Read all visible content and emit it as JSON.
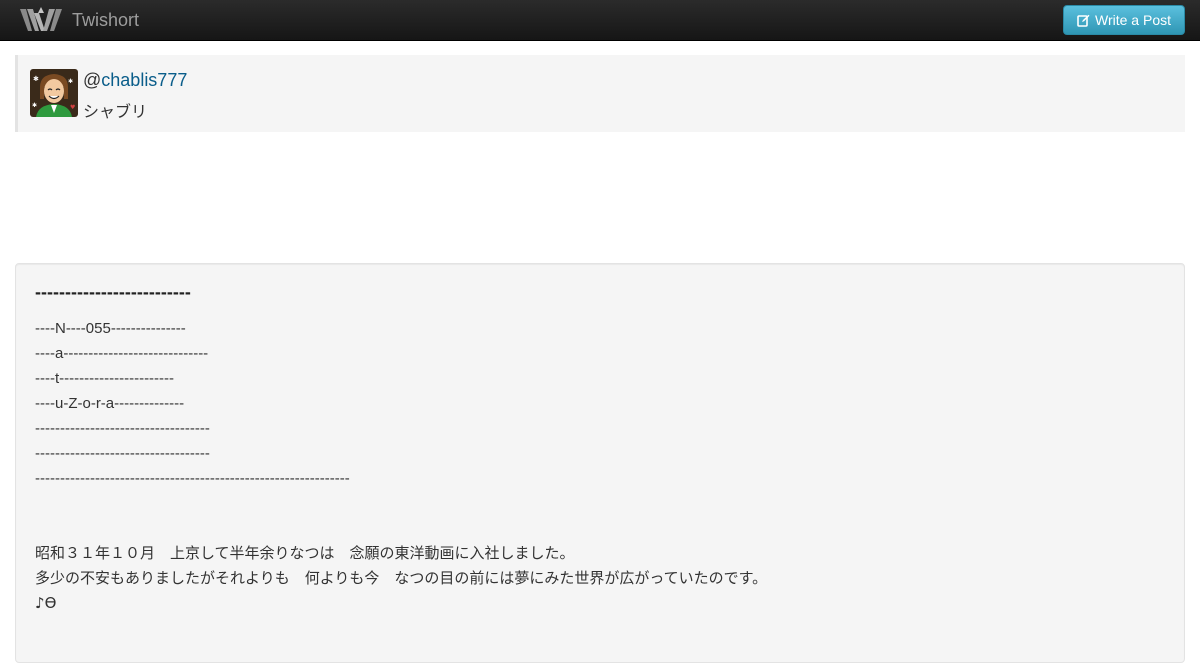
{
  "navbar": {
    "brand_text": "Twishort",
    "logo_icon": "twishort-logo-icon",
    "write_button_label": "Write a Post",
    "write_button_icon": "edit-icon",
    "write_button_color": "#5bc0de"
  },
  "profile": {
    "at_sign": "@",
    "username": "chablis777",
    "display_name": "シャブリ",
    "link_color": "#0a5d8a"
  },
  "post": {
    "heading": "--------------------------",
    "lines": [
      "----N----055---------------",
      "----a-----------------------------",
      "----t-----------------------",
      "----u-Z-o-r-a--------------",
      "-----------------------------------",
      "-----------------------------------",
      "---------------------------------------------------------------",
      "",
      "",
      "昭和３１年１０月　上京して半年余りなつは　念願の東洋動画に入社しました。",
      "多少の不安もありましたがそれよりも　何よりも今　なつの目の前には夢にみた世界が広がっていたのです。",
      "♪Ѳ"
    ]
  }
}
